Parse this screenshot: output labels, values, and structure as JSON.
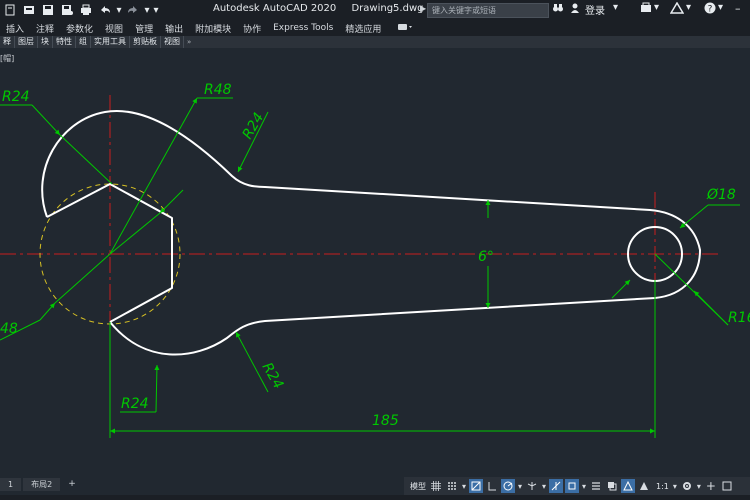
{
  "window": {
    "app_title": "Autodesk AutoCAD 2020",
    "file_name": "Drawing5.dwg",
    "search_placeholder": "键入关键字或短语",
    "sign_in": "登录"
  },
  "ribbon": {
    "tabs": [
      "插入",
      "注释",
      "参数化",
      "视图",
      "管理",
      "输出",
      "附加模块",
      "协作",
      "Express Tools",
      "精选应用"
    ],
    "panels": [
      "释",
      "图层",
      "块",
      "特性",
      "组",
      "实用工具",
      "剪贴板",
      "视图"
    ]
  },
  "viewport": {
    "label": "[帽]"
  },
  "drawing": {
    "dimensions": {
      "r48_top": "R48",
      "r24_top_left": "R24",
      "r24_upper_neck": "R24",
      "r24_lower_neck": "R24",
      "r24_bottom": "R24",
      "r48_left_partial": "48",
      "diameter": "Ø18",
      "r16_partial": "R16",
      "angle": "6°",
      "length": "185"
    },
    "colors": {
      "background": "#212830",
      "outline": "#ffffff",
      "dimension": "#00c800",
      "centerline": "#c81e1e",
      "hidden_circle": "#d6c024"
    }
  },
  "layout_tabs": [
    "1",
    "布局2"
  ],
  "status_bar": {
    "model": "模型",
    "scale": "1:1"
  },
  "icons": {
    "qat": [
      "new-icon",
      "open-icon",
      "save-icon",
      "save-as-icon",
      "print-icon",
      "undo-icon",
      "redo-icon"
    ],
    "status": [
      "grid-icon",
      "snap-icon",
      "ortho-icon",
      "polar-icon",
      "osnap-icon",
      "otrack-icon",
      "lineweight-icon",
      "annotation-icon",
      "workspace-icon",
      "fullscreen-icon"
    ]
  }
}
